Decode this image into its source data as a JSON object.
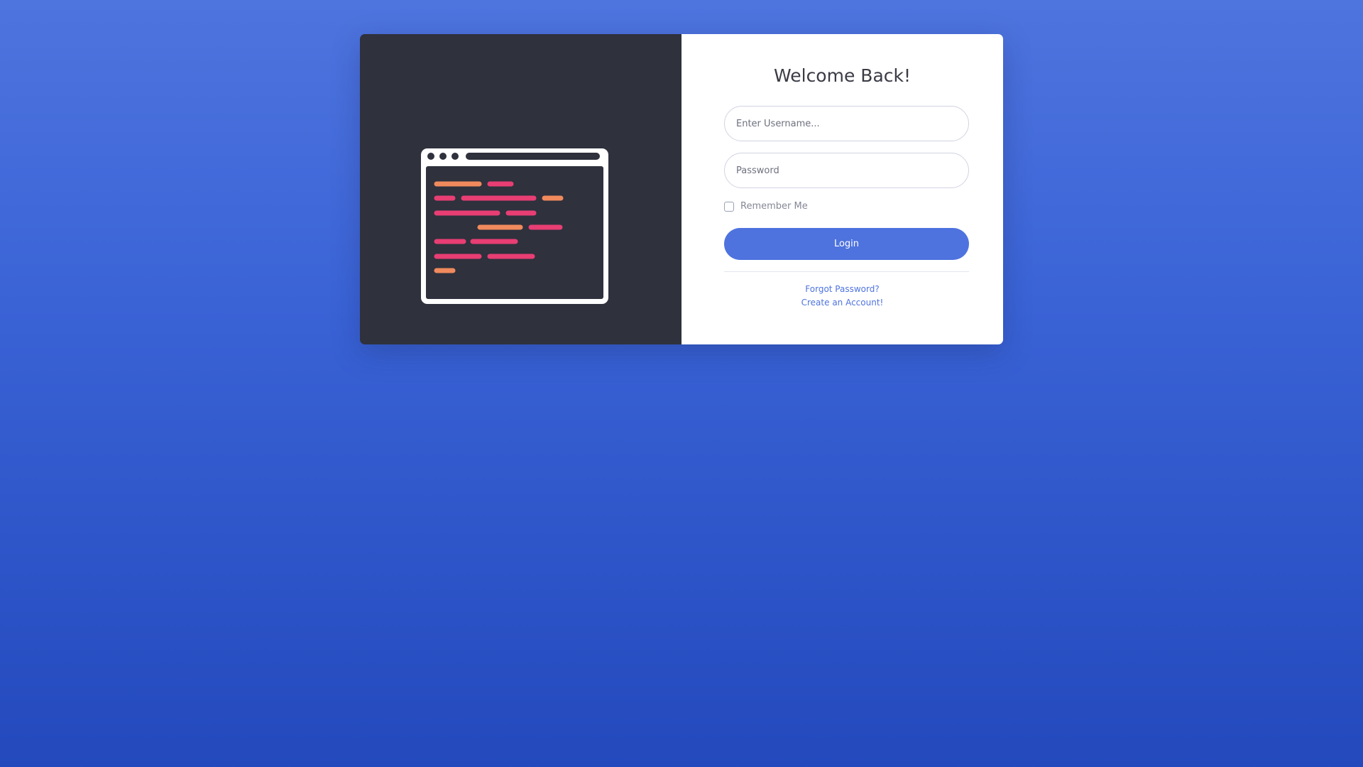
{
  "login": {
    "title": "Welcome Back!",
    "username_placeholder": "Enter Username...",
    "password_placeholder": "Password",
    "remember_label": "Remember Me",
    "remember_checked": false,
    "login_button": "Login",
    "forgot_password_link": "Forgot Password?",
    "create_account_link": "Create an Account!"
  },
  "illustration": {
    "icon": "code-editor-window-icon"
  },
  "colors": {
    "page_gradient_top": "#4e74de",
    "page_gradient_bottom": "#2349bd",
    "panel_dark": "#2f313d",
    "accent": "#4e73df",
    "code_pink": "#e83e73",
    "code_orange": "#f08a5d"
  }
}
